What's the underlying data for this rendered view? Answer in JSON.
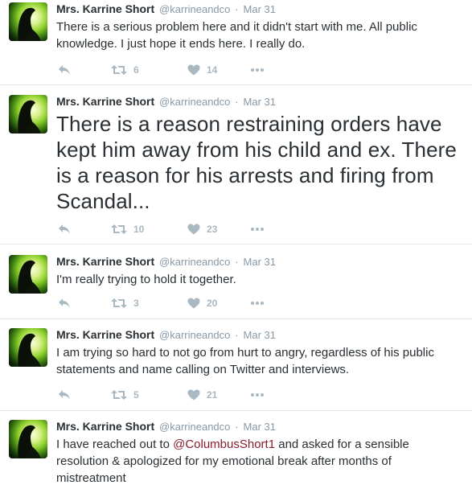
{
  "tweets": [
    {
      "name": "Mrs. Karrine Short",
      "handle": "@karrineandco",
      "separator": "·",
      "date": "Mar 31",
      "text": "There is a serious problem here and it didn't start with me. All public knowledge. I just hope it ends here. I really do.",
      "retweets": "6",
      "likes": "14"
    },
    {
      "name": "Mrs. Karrine Short",
      "handle": "@karrineandco",
      "separator": "·",
      "date": "Mar 31",
      "text": "There is a reason restraining orders have kept him away from his child and ex. There is a reason for his arrests and firing from Scandal...",
      "retweets": "10",
      "likes": "23"
    },
    {
      "name": "Mrs. Karrine Short",
      "handle": "@karrineandco",
      "separator": "·",
      "date": "Mar 31",
      "text": "I'm really trying to hold it together.",
      "retweets": "3",
      "likes": "20"
    },
    {
      "name": "Mrs. Karrine Short",
      "handle": "@karrineandco",
      "separator": "·",
      "date": "Mar 31",
      "text": "I am trying so hard to not go from hurt to angry, regardless of his public statements and name calling on Twitter and interviews.",
      "retweets": "5",
      "likes": "21"
    },
    {
      "name": "Mrs. Karrine Short",
      "handle": "@karrineandco",
      "separator": "·",
      "date": "Mar 31",
      "text_before": "I have reached out to ",
      "mention": "@ColumbusShort1",
      "text_after": " and asked for a sensible resolution & apologized for my emotional break after months of mistreatment"
    }
  ],
  "icons": {
    "reply": "reply-icon",
    "retweet": "retweet-icon",
    "like": "heart-icon",
    "more": "more-dots-icon"
  },
  "colors": {
    "text": "#292f33",
    "meta": "#8899a6",
    "action": "#aab8c2",
    "mention": "#8a1d2b",
    "divider": "#e1e8ed"
  }
}
